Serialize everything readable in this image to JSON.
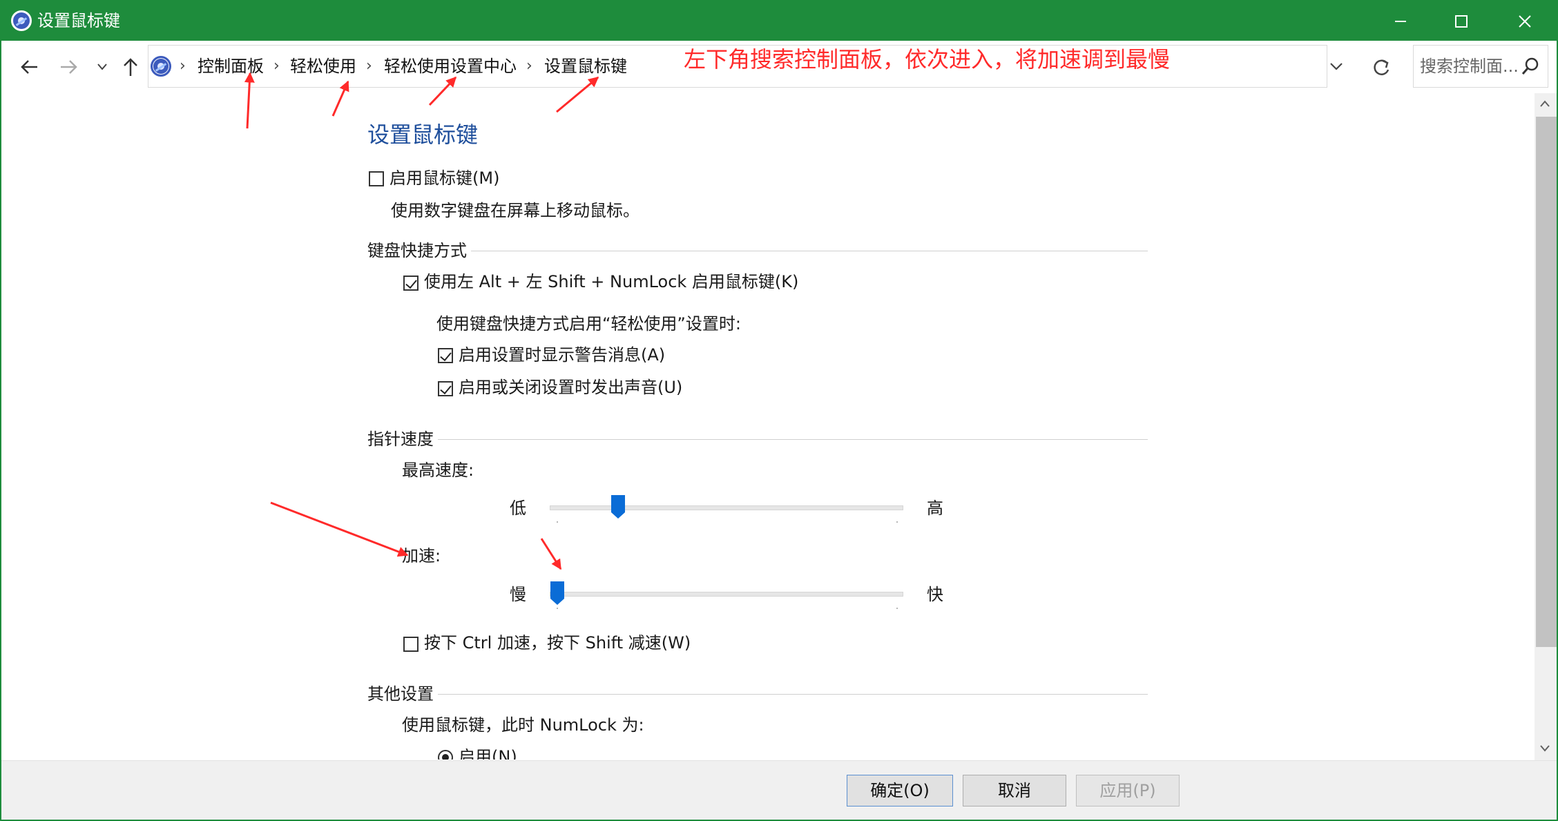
{
  "window": {
    "title": "设置鼠标键"
  },
  "navigation": {
    "breadcrumbs": [
      "控制面板",
      "轻松使用",
      "轻松使用设置中心",
      "设置鼠标键"
    ],
    "search_placeholder": "搜索控制面...",
    "annotation": "左下角搜索控制面板，依次进入，将加速调到最慢"
  },
  "page": {
    "heading": "设置鼠标键",
    "enable_mousekeys": {
      "label": "启用鼠标键(M)",
      "checked": false
    },
    "enable_description": "使用数字键盘在屏幕上移动鼠标。",
    "keyboard_shortcut_group": "键盘快捷方式",
    "shortcut_option": {
      "label": "使用左 Alt + 左 Shift + NumLock 启用鼠标键(K)",
      "checked": true
    },
    "shortcut_subheading": "使用键盘快捷方式启用“轻松使用”设置时:",
    "warning_option": {
      "label": "启用设置时显示警告消息(A)",
      "checked": true
    },
    "sound_option": {
      "label": "启用或关闭设置时发出声音(U)",
      "checked": true
    },
    "pointer_speed_group": "指针速度",
    "top_speed": {
      "label": "最高速度:",
      "low": "低",
      "high": "高",
      "level": 0.18
    },
    "acceleration": {
      "label": "加速:",
      "low": "慢",
      "high": "快",
      "level": 0.0
    },
    "ctrl_shift_option": {
      "label": "按下 Ctrl 加速，按下 Shift 减速(W)",
      "checked": false
    },
    "other_group": "其他设置",
    "numlock_label": "使用鼠标键，此时 NumLock 为:",
    "numlock_on_option": {
      "label": "启用(N)",
      "selected": true
    }
  },
  "buttons": {
    "ok": "确定(O)",
    "cancel": "取消",
    "apply": "应用(P)"
  },
  "colors": {
    "titlebar": "#1e8c3c",
    "accent": "#0a6cd6",
    "annotation": "#ff2a2a",
    "heading": "#1f4f9c"
  }
}
